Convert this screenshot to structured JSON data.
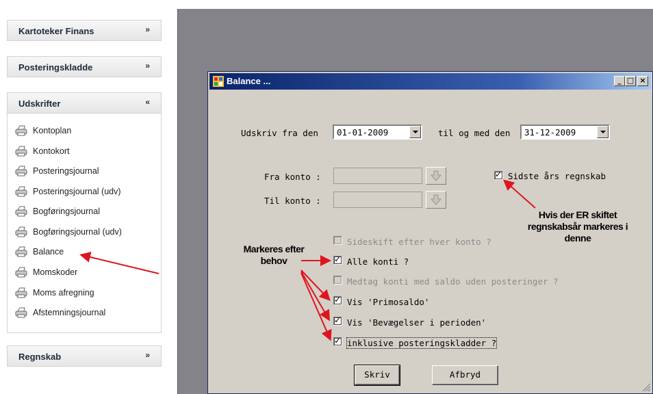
{
  "sidebar": {
    "sections": [
      {
        "title": "Kartoteker Finans",
        "chevron": "»",
        "state": "collapsed"
      },
      {
        "title": "Posteringskladde",
        "chevron": "»",
        "state": "collapsed"
      },
      {
        "title": "Udskrifter",
        "chevron": "«",
        "state": "expanded"
      },
      {
        "title": "Regnskab",
        "chevron": "»",
        "state": "collapsed"
      }
    ],
    "items": [
      {
        "label": "Kontoplan",
        "icon": "printer-icon"
      },
      {
        "label": "Kontokort",
        "icon": "printer-icon"
      },
      {
        "label": "Posteringsjournal",
        "icon": "printer-icon"
      },
      {
        "label": "Posteringsjournal (udv)",
        "icon": "printer-icon"
      },
      {
        "label": "Bogføringsjournal",
        "icon": "printer-icon"
      },
      {
        "label": "Bogføringsjournal (udv)",
        "icon": "printer-icon"
      },
      {
        "label": "Balance",
        "icon": "printer-icon"
      },
      {
        "label": "Momskoder",
        "icon": "printer-icon"
      },
      {
        "label": "Moms afregning",
        "icon": "printer-icon"
      },
      {
        "label": "Afstemningsjournal",
        "icon": "printer-icon"
      }
    ]
  },
  "dialog": {
    "title": "Balance ...",
    "controls": {
      "minimize": "_",
      "maximize": "□",
      "close": "×"
    },
    "from_date_label": "Udskriv fra den",
    "from_date": "01-01-2009",
    "to_date_label": "til og med den",
    "to_date": "31-12-2009",
    "from_account_label": "Fra konto :",
    "from_account": "",
    "to_account_label": "Til konto :",
    "to_account": "",
    "last_year_label": "Sidste års regnskab",
    "last_year_checked": true,
    "options": [
      {
        "label": "Sideskift efter hver konto ?",
        "checked": false,
        "enabled": false
      },
      {
        "label": "Alle konti ?",
        "checked": true,
        "enabled": true
      },
      {
        "label": "Medtag konti med saldo uden posteringer ?",
        "checked": false,
        "enabled": false
      },
      {
        "label": "Vis 'Primosaldo'",
        "checked": true,
        "enabled": true
      },
      {
        "label": "Vis 'Bevægelser i perioden'",
        "checked": true,
        "enabled": true
      },
      {
        "label": "inklusive posteringskladder ?",
        "checked": true,
        "enabled": true
      }
    ],
    "print_button": "Skriv",
    "cancel_button": "Afbryd"
  },
  "annotations": {
    "note_right_1": "Hvis der ER skiftet",
    "note_right_2": "regnskabsår markeres i",
    "note_right_3": "denne",
    "note_left_1": "Markeres efter",
    "note_left_2": "behov"
  },
  "colors": {
    "titlebar_start": "#0a246a",
    "titlebar_end": "#a6caf0",
    "dialog_face": "#d4d0c8",
    "workspace": "#838389",
    "arrow": "#e0141e"
  }
}
